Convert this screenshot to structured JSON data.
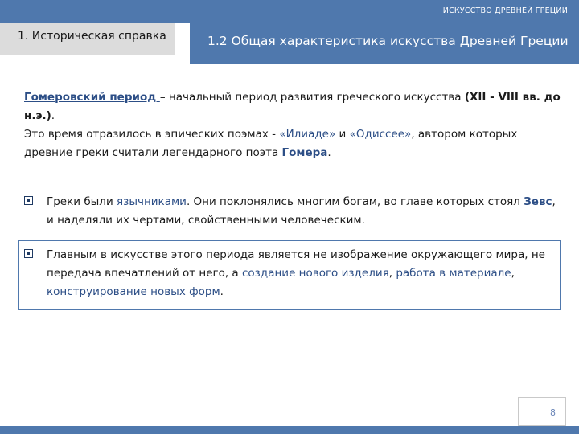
{
  "header": {
    "deck_title": "ИСКУССТВО ДРЕВНЕЙ ГРЕЦИИ",
    "section_tab": "1. Историческая справка",
    "slide_title": "1.2 Общая характеристика искусства Древней Греции"
  },
  "intro": {
    "term": "Гомеровский период ",
    "def1": "– начальный период развития греческого искусства  ",
    "dates": "(XII - VIII вв. до н.э.)",
    "dot": ".",
    "line2_pre": "Это время отразилось в эпических поэмах - ",
    "iliad": "«Илиаде»",
    "and": " и ",
    "odyssey": "«Одиссее»",
    "line2_post": ", автором которых древние греки считали легендарного поэта ",
    "homer": "Гомера",
    "end": "."
  },
  "bullets": [
    {
      "t1": "Греки были ",
      "pagans": "язычниками",
      "t2": ". Они поклонялись многим богам, во главе которых стоял ",
      "zeus": "Зевс",
      "t3": ", и наделяли их чертами, свойственными человеческим."
    },
    {
      "t1": "Главным в искусстве этого периода является не изображение окружающего мира, не передача впечатлений от него, а ",
      "creation": "создание нового изделия",
      "c1": ", ",
      "work": "работа в материале",
      "c2": ", ",
      "construct": "конструирование новых форм",
      "end": "."
    }
  ],
  "footer": {
    "page_number": "8"
  },
  "colors": {
    "accent": "#4f78ad",
    "highlight": "#2c4e86",
    "tab_gray": "#dcdcdc"
  },
  "icons": {
    "bullet": "checkbox-square-bullet-icon"
  }
}
